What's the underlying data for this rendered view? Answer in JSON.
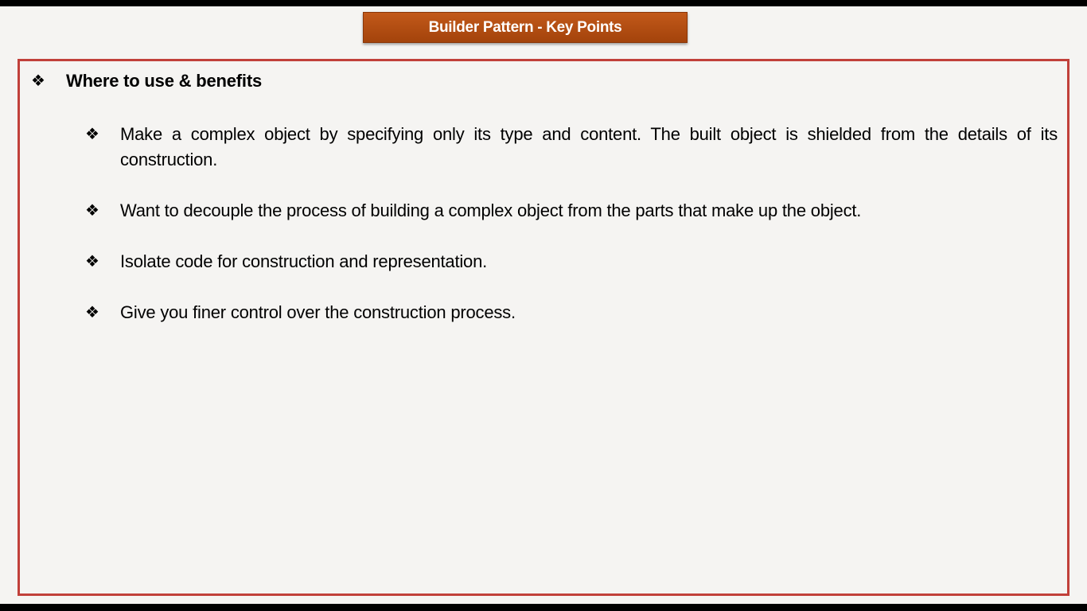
{
  "slide": {
    "title": "Builder Pattern - Key Points",
    "section": {
      "heading": "Where to use & benefits",
      "bullet_icon": "diamond-four-bullet",
      "bullet_glyph": "❖",
      "items": [
        {
          "text": "Make a complex object by specifying only its type and content. The built object is shielded from the details of its construction."
        },
        {
          "text": "Want to decouple the process of building a complex object from the parts that make up the object."
        },
        {
          "text": "Isolate code for construction and representation."
        },
        {
          "text": "Give you finer control over the construction process."
        }
      ]
    }
  },
  "colors": {
    "title_bg": "#b24d12",
    "title_text": "#ffffff",
    "border": "#c1403a",
    "background": "#f5f4f2"
  }
}
